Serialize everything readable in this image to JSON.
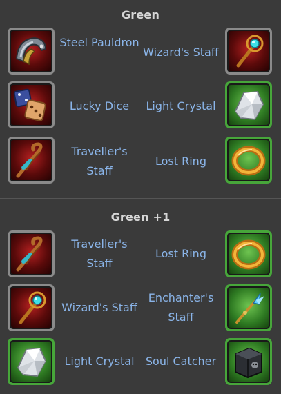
{
  "sections": [
    {
      "title": "Green",
      "rows": [
        {
          "left": {
            "name": "Steel Pauldron",
            "icon": "steel-pauldron-icon",
            "frame": "red"
          },
          "right": {
            "name": "Wizard's Staff",
            "icon": "wizards-staff-icon",
            "frame": "red"
          }
        },
        {
          "left": {
            "name": "Lucky Dice",
            "icon": "lucky-dice-icon",
            "frame": "red"
          },
          "right": {
            "name": "Light Crystal",
            "icon": "light-crystal-icon",
            "frame": "green"
          }
        },
        {
          "left": {
            "name": "Traveller's Staff",
            "icon": "travellers-staff-icon",
            "frame": "red"
          },
          "right": {
            "name": "Lost Ring",
            "icon": "lost-ring-icon",
            "frame": "green"
          }
        }
      ]
    },
    {
      "title": "Green +1",
      "rows": [
        {
          "left": {
            "name": "Traveller's Staff",
            "icon": "travellers-staff-icon",
            "frame": "red"
          },
          "right": {
            "name": "Lost Ring",
            "icon": "lost-ring-icon",
            "frame": "green"
          }
        },
        {
          "left": {
            "name": "Wizard's Staff",
            "icon": "wizards-staff-icon",
            "frame": "red"
          },
          "right": {
            "name": "Enchanter's Staff",
            "icon": "enchanters-staff-icon",
            "frame": "green"
          }
        },
        {
          "left": {
            "name": "Light Crystal",
            "icon": "light-crystal-icon",
            "frame": "green"
          },
          "right": {
            "name": "Soul Catcher",
            "icon": "soul-catcher-icon",
            "frame": "green"
          }
        }
      ]
    }
  ],
  "colors": {
    "background": "#3a3a3a",
    "item_name": "#8ab4e8",
    "section_title": "#d6d6d6",
    "frame_red_border": "#8a8a8a",
    "frame_green_border": "#47a63a"
  }
}
